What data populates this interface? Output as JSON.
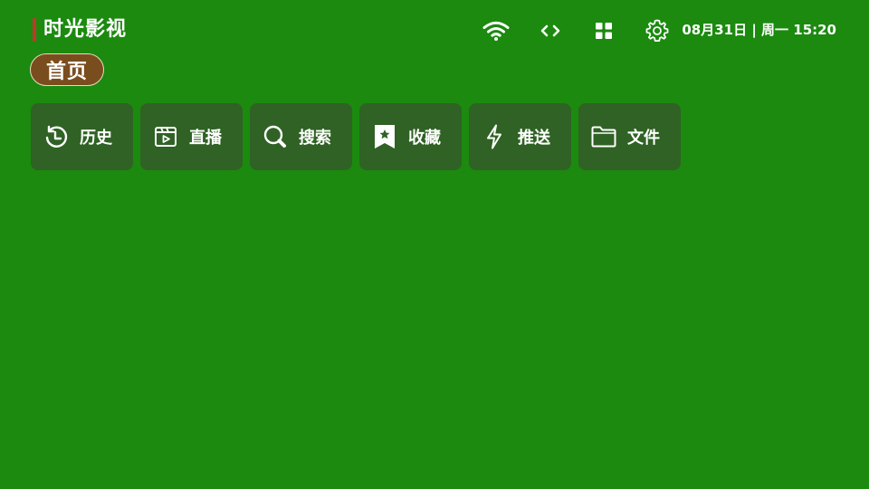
{
  "header": {
    "app_title": "时光影视",
    "datetime": "08月31日 | 周一 15:20",
    "icons": [
      "wifi-icon",
      "code-icon",
      "grid-icon",
      "gear-icon"
    ]
  },
  "tabs": {
    "home_label": "首页"
  },
  "quick_actions": [
    {
      "label": "历史",
      "icon": "history-icon"
    },
    {
      "label": "直播",
      "icon": "live-icon"
    },
    {
      "label": "搜索",
      "icon": "search-icon"
    },
    {
      "label": "收藏",
      "icon": "bookmark-star-icon"
    },
    {
      "label": "推送",
      "icon": "lightning-icon"
    },
    {
      "label": "文件",
      "icon": "folder-icon"
    }
  ],
  "colors": {
    "background": "#1b8a0f",
    "button_bg": "#2f6224",
    "home_tab_bg": "#7a4d1f",
    "title_accent": "#c0392b"
  }
}
